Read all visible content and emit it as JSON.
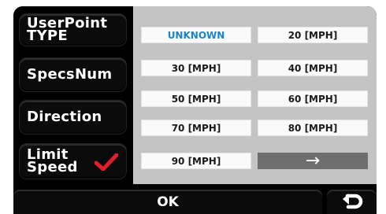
{
  "sidebar": {
    "items": [
      {
        "label": "UserPoint\nTYPE",
        "selected": false
      },
      {
        "label": "SpecsNum",
        "selected": false
      },
      {
        "label": "Direction",
        "selected": false
      },
      {
        "label": "Limit\nSpeed",
        "selected": true
      }
    ]
  },
  "options": {
    "items": [
      "UNKNOWN",
      "20 [MPH]",
      "30 [MPH]",
      "40 [MPH]",
      "50 [MPH]",
      "60 [MPH]",
      "70 [MPH]",
      "80 [MPH]",
      "90 [MPH]"
    ],
    "selected": "UNKNOWN",
    "next_arrow": "→"
  },
  "footer": {
    "ok_label": "OK",
    "back_icon": "back-icon"
  },
  "colors": {
    "panel_bg": "#c4c4c4",
    "selected_text": "#1b84c6",
    "check": "#e0202a",
    "arrow_bg": "#6e6e6e"
  }
}
